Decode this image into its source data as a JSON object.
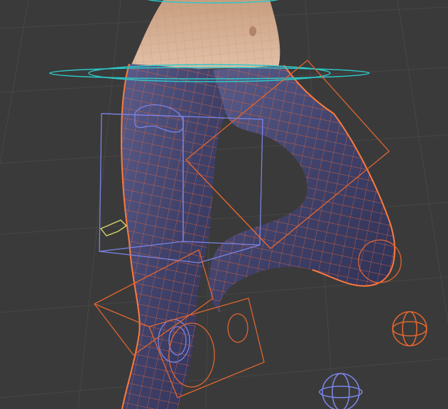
{
  "viewport": {
    "label": "",
    "background": "#3a3a3a",
    "grid_color": "#454545",
    "mesh": {
      "skin_fill": "#d6b39a",
      "pants_fill": "#4a4c76",
      "wire_color": "#e0653a",
      "highlight": "#ff7a3a"
    },
    "rig": {
      "cyan_color": "#2fc7c7",
      "blue_color": "#7a84e6",
      "orange_color": "#e0652e",
      "yellow_color": "#d6d46a"
    }
  }
}
